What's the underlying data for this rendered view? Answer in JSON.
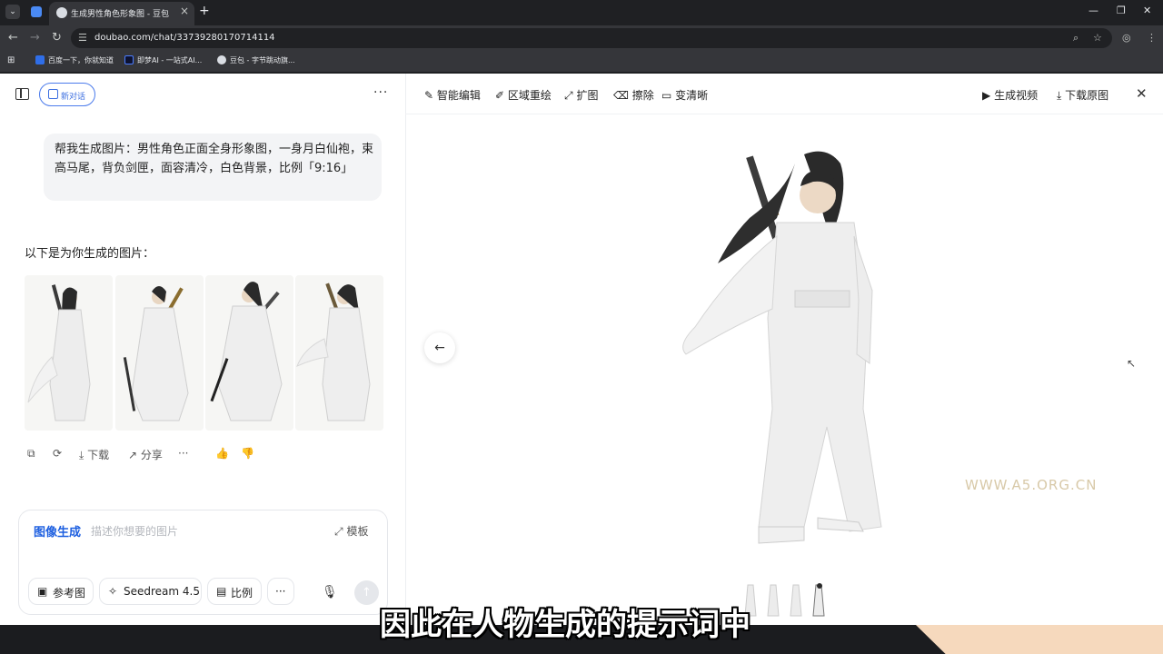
{
  "browser": {
    "tab_title": "生成男性角色形象图 - 豆包",
    "url": "doubao.com/chat/33739280170714114",
    "bookmarks": [
      "百度一下，你就知道",
      "即梦AI - 一站式AI...",
      "豆包 - 字节跳动旗..."
    ]
  },
  "left_panel": {
    "new_chat_label": "新对话",
    "user_prompt": "帮我生成图片：男性角色正面全身形象图，一身月白仙袍，束高马尾，背负剑匣，面容清冷，白色背景，比例「9:16」",
    "reply_text": "以下是为你生成的图片：",
    "actions": {
      "download": "下载",
      "share": "分享"
    },
    "input": {
      "mode_label": "图像生成",
      "placeholder": "描述你想要的图片",
      "template_label": "模板",
      "chips": [
        "参考图",
        "Seedream 4.5",
        "比例"
      ]
    }
  },
  "viewer": {
    "tools": [
      "智能编辑",
      "区域重绘",
      "扩图",
      "擦除",
      "变清晰"
    ],
    "right_actions": [
      "生成视频",
      "下载原图"
    ],
    "watermark": "WWW.A5.ORG.CN"
  },
  "caption": "因此在人物生成的提示词中",
  "colors": {
    "accent": "#1d5fe0",
    "chrome_dark": "#35363a"
  },
  "icons": [
    "sidebar-icon",
    "edit-icon",
    "more-icon",
    "copy-icon",
    "refresh-icon",
    "download-icon",
    "share-icon",
    "thumbs-up-icon",
    "thumbs-down-icon",
    "image-icon",
    "sparkle-icon",
    "ratio-icon",
    "mic-icon",
    "send-icon",
    "arrow-left-icon",
    "close-icon"
  ]
}
